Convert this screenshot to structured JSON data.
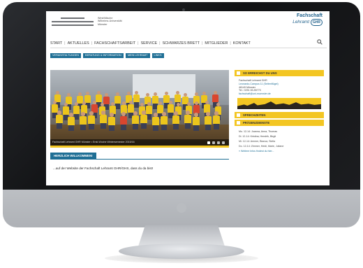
{
  "site": {
    "logo_text": "Westfälische\nWilhelms-Universität\nMünster",
    "fs_title": "Fachschaft",
    "fs_subtitle": "Lehramt",
    "fs_badge": "GHR"
  },
  "nav": {
    "items": [
      "START",
      "AKTUELLES",
      "FACHSCHAFTSARBEIT",
      "SERVICE",
      "SCHWARZES BRETT",
      "MITGLIEDER",
      "KONTAKT"
    ],
    "separator": "|"
  },
  "quicklinks": [
    "VERANSTALTUNGEN",
    "BERATUNG & INFORMATION",
    "MEIN LEHRAMT",
    "LINKS"
  ],
  "hero": {
    "caption": "Fachschaft Lehramt GHR Münster • Ersti-Woche Wintersemester 2015/16"
  },
  "welcome": {
    "tab": "HERZLICH WILLKOMMEN!",
    "text": "...auf der Website der Fachschaft Lehramt GHR/GHS, dass du da bist!"
  },
  "sidebar": {
    "contact_head": "SO ERREICHST DU UNS",
    "contact_lines": [
      "Fachschaft Lehramt GHR",
      "Leonardo-Campus 11 (Seitenflügel)",
      "48149 Münster",
      "Tel.: 0251 83-55770"
    ],
    "contact_email": "fachschaft@uni-muenster.de",
    "sprechzeiten_head": "SPRECHZEITEN",
    "praesenz_head": "PRÄSENZDIENSTE",
    "schedule": [
      "Mo. 12-14: Joanna, Anna, Thomas",
      "Di. 12-14: Kristina, Hendrik, Birgit",
      "Mi. 12-14: Ammer, Bianca, Stella",
      "Do. 12-14: Zimmer, Heidi, Marie, Juliane"
    ],
    "schedule_more": "» Weitere Infos findest du hier..."
  },
  "colors": {
    "accent": "#f3c623",
    "brand_blue": "#1f6f95",
    "nav_text": "#333333"
  },
  "icons": {
    "search": "magnifier"
  }
}
